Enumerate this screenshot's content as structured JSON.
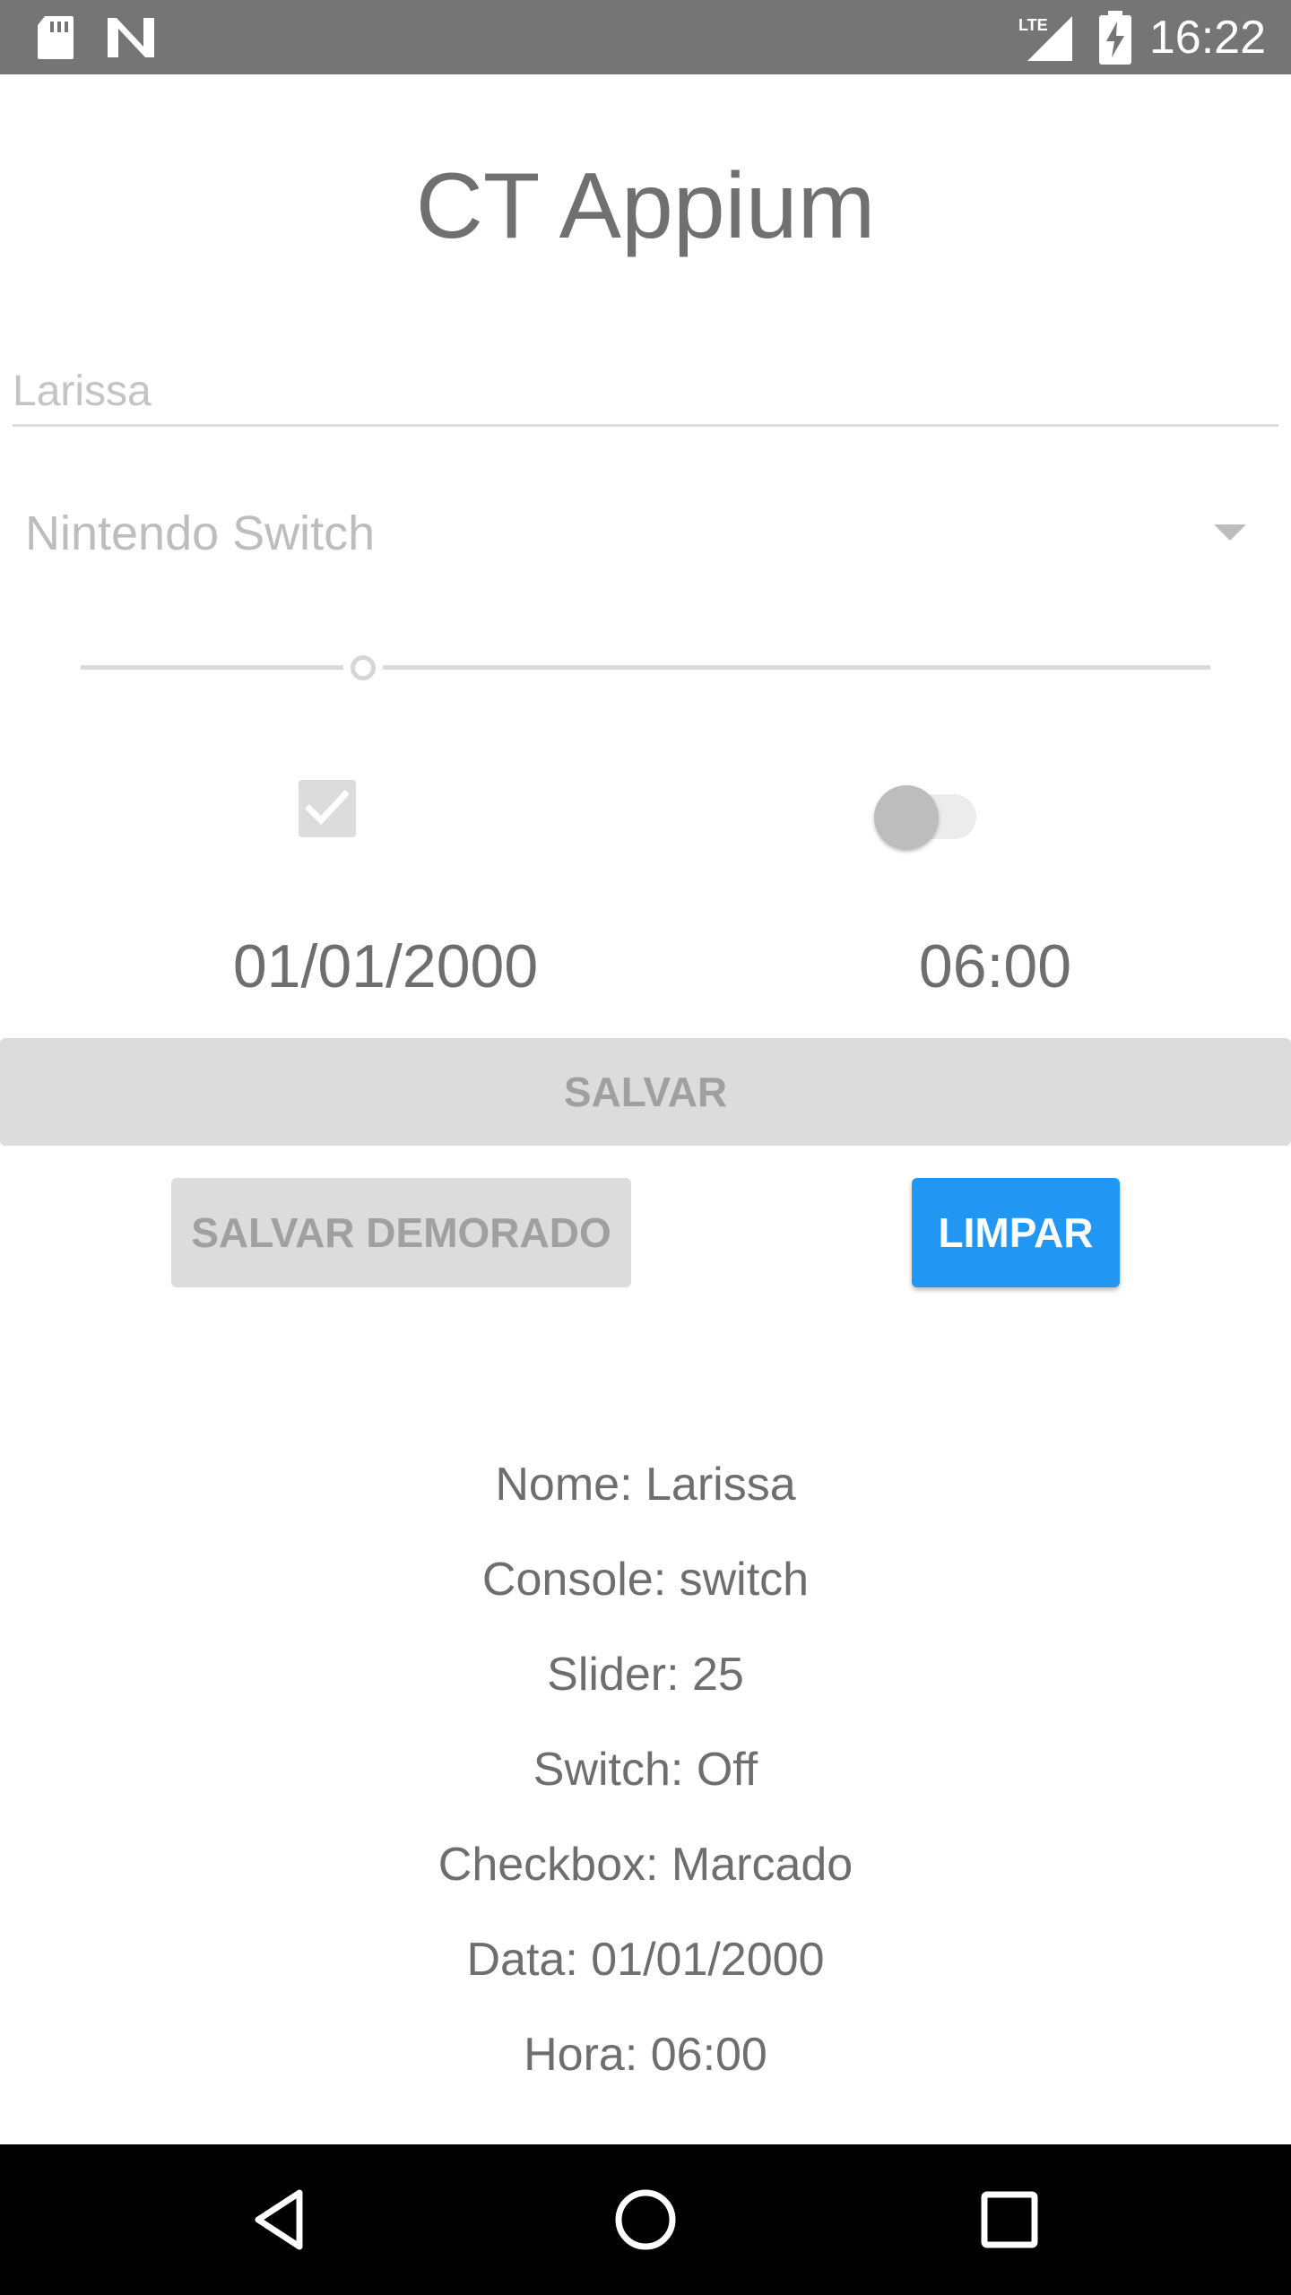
{
  "status_bar": {
    "time": "16:22",
    "icons": [
      "sd-card-icon",
      "n-notification-icon",
      "lte-signal-icon",
      "battery-charging-icon"
    ],
    "network_label": "LTE"
  },
  "app": {
    "title": "CT Appium"
  },
  "form": {
    "name_placeholder": "Larissa",
    "console_selected": "Nintendo Switch",
    "slider_value_percent": 25,
    "checkbox_checked": true,
    "switch_on": false,
    "date": "01/01/2000",
    "time": "06:00"
  },
  "buttons": {
    "salvar": "SALVAR",
    "salvar_demorado": "SALVAR DEMORADO",
    "limpar": "LIMPAR"
  },
  "results": [
    "Nome: Larissa",
    "Console: switch",
    "Slider: 25",
    "Switch: Off",
    "Checkbox: Marcado",
    "Data: 01/01/2000",
    "Hora: 06:00"
  ],
  "nav_bar": {
    "icons": [
      "back-icon",
      "home-icon",
      "recents-icon"
    ]
  },
  "colors": {
    "status_bar": "#757575",
    "accent": "#2196f3",
    "disabled_button": "#dcdcdc",
    "nav_bar": "#000000"
  }
}
